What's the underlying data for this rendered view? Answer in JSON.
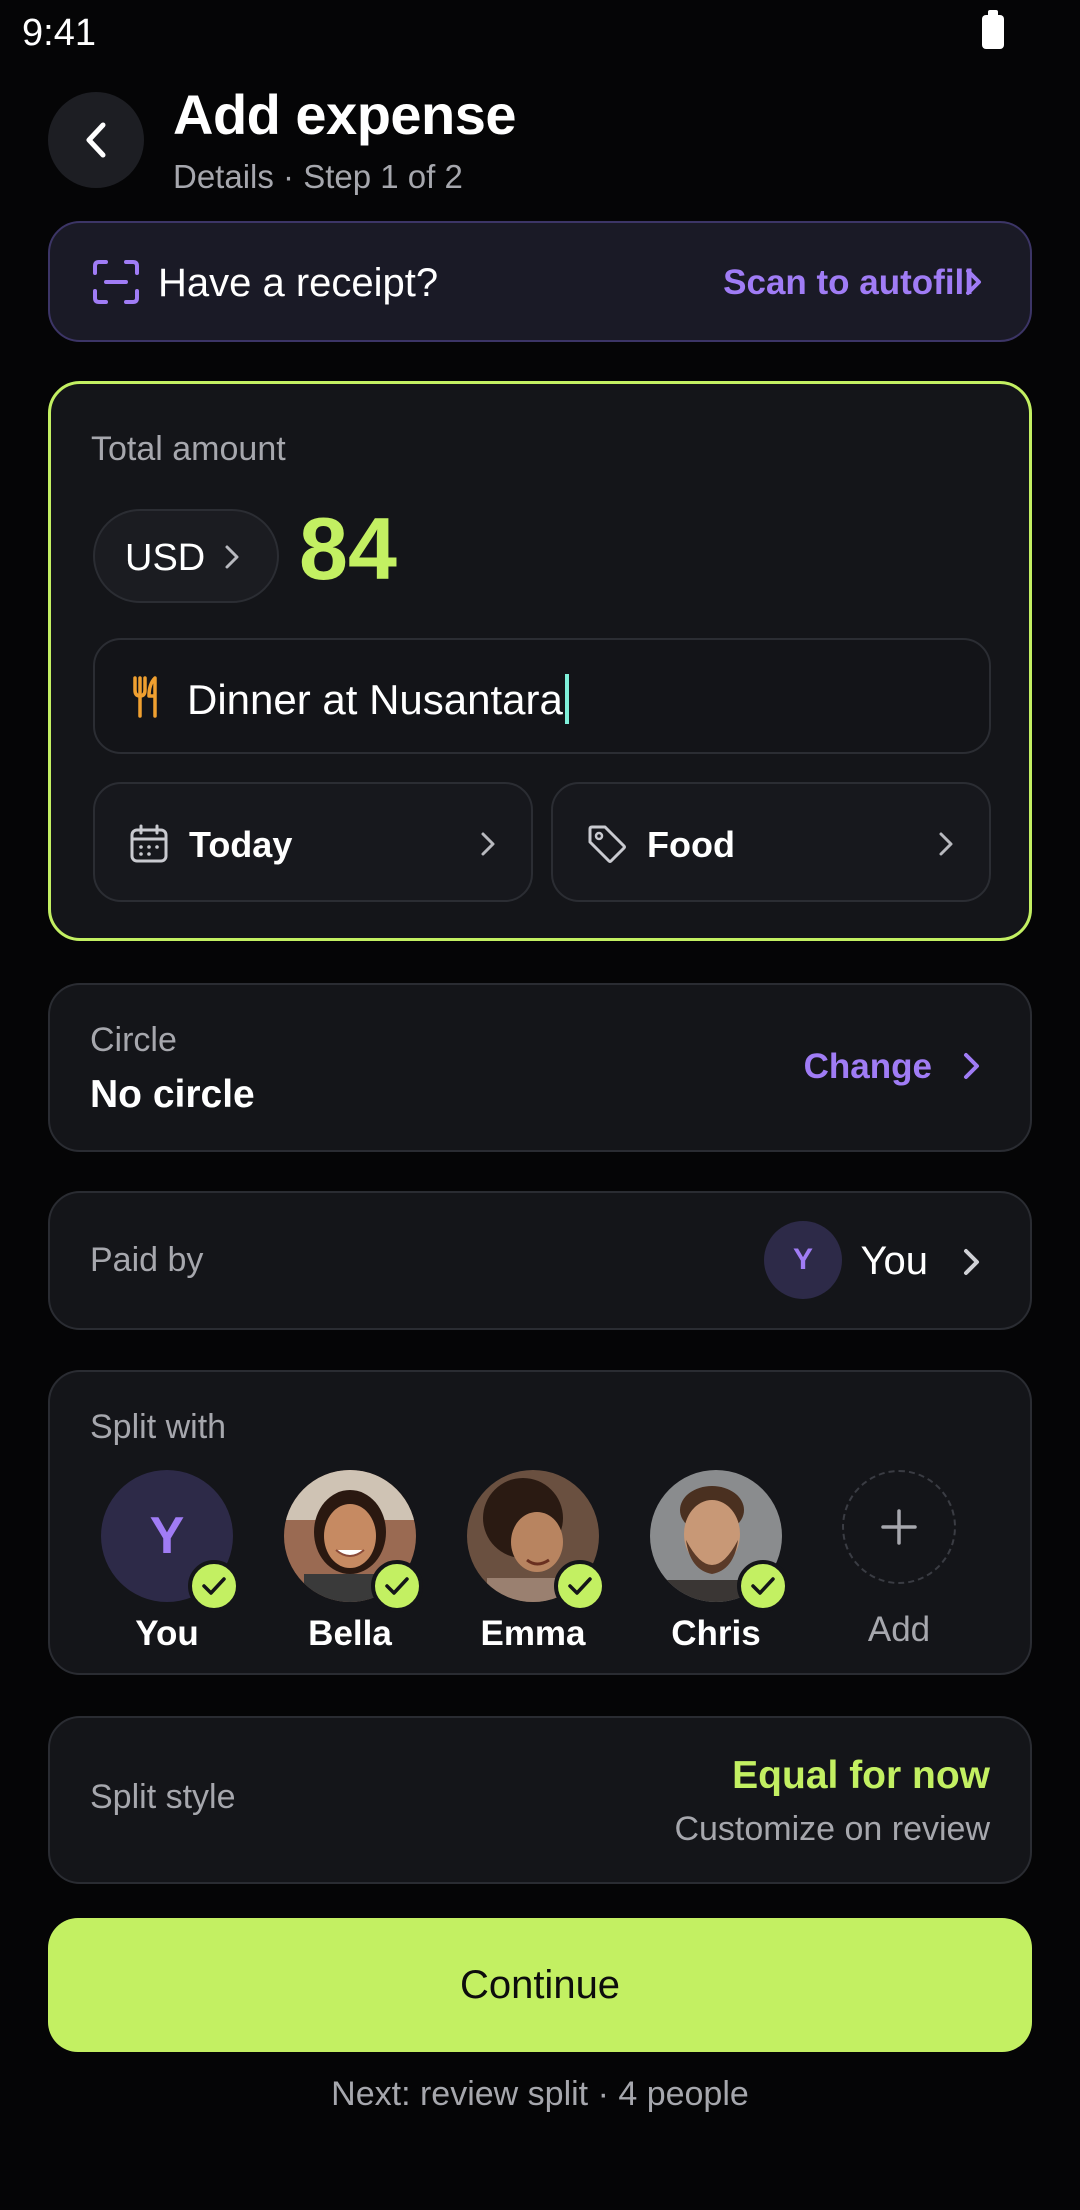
{
  "status_bar": {
    "time": "9:41"
  },
  "header": {
    "title": "Add expense",
    "subtitle": "Details · Step 1 of 2"
  },
  "receipt_banner": {
    "prompt": "Have a receipt?",
    "action": "Scan to autofill"
  },
  "amount_card": {
    "label": "Total amount",
    "currency": "USD",
    "amount": "84",
    "description": "Dinner at Nusantara",
    "date_chip": "Today",
    "category_chip": "Food"
  },
  "circle_card": {
    "label": "Circle",
    "value": "No circle",
    "action": "Change"
  },
  "paid_by": {
    "label": "Paid by",
    "initial": "Y",
    "name": "You"
  },
  "split_with": {
    "label": "Split with",
    "members": [
      {
        "name": "You",
        "initial": "Y",
        "selected": true
      },
      {
        "name": "Bella",
        "selected": true
      },
      {
        "name": "Emma",
        "selected": true
      },
      {
        "name": "Chris",
        "selected": true
      }
    ],
    "add_label": "Add"
  },
  "split_style": {
    "label": "Split style",
    "value": "Equal for now",
    "note": "Customize on review"
  },
  "continue_label": "Continue",
  "footer_note": "Next: review split · 4 people",
  "colors": {
    "accent_green": "#c3f062",
    "accent_purple": "#a07cf5",
    "background": "#050506",
    "card": "#141519"
  }
}
